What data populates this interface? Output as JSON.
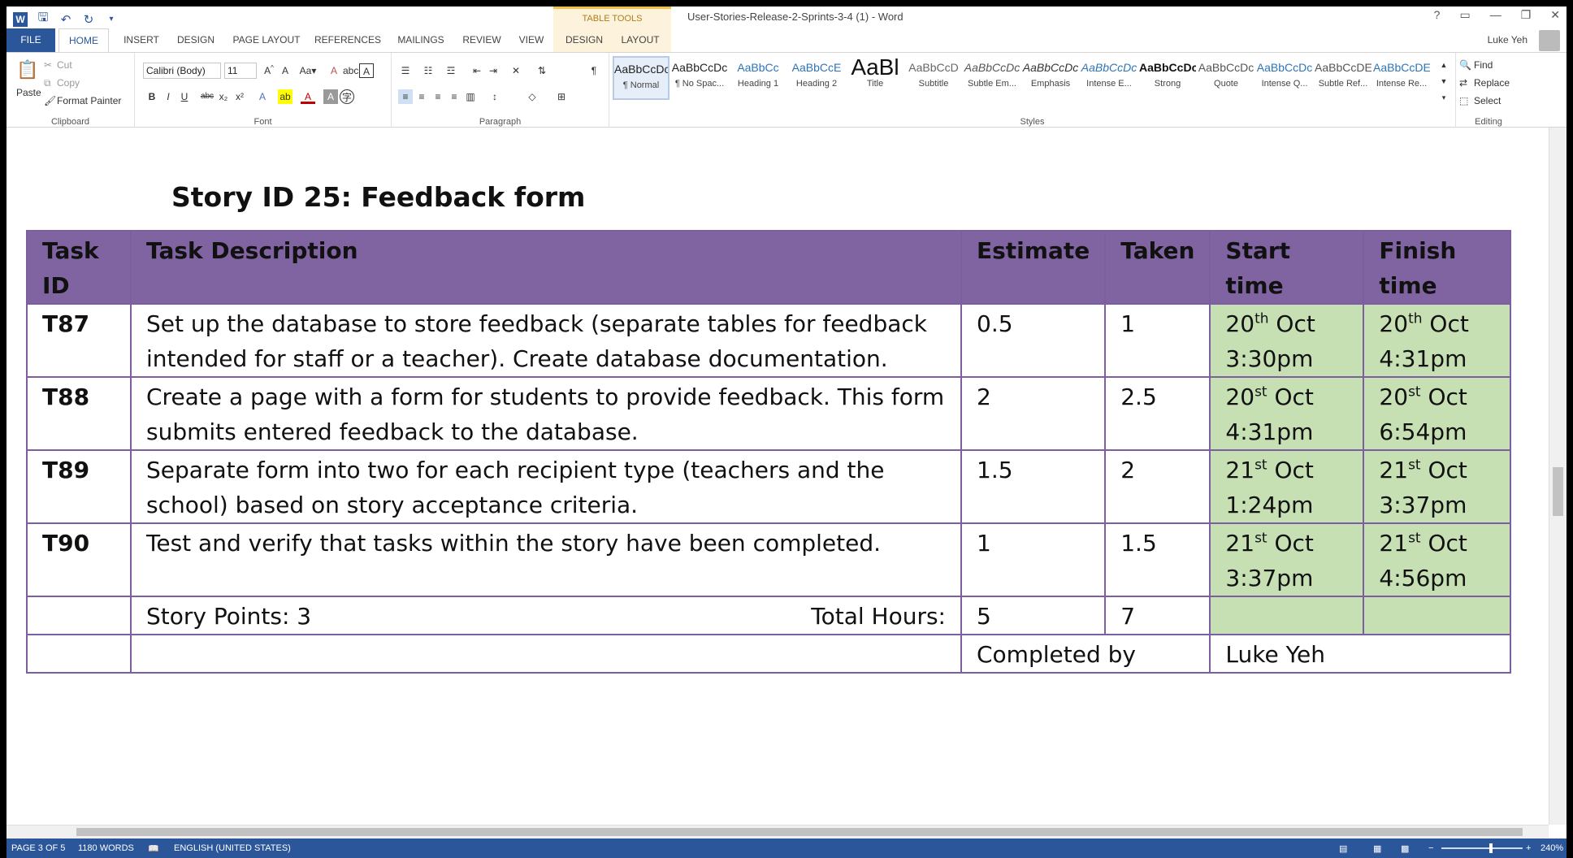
{
  "app": {
    "doc_title": "User-Stories-Release-2-Sprints-3-4 (1) - Word",
    "user": "Luke Yeh",
    "table_tools": "TABLE TOOLS"
  },
  "qat": [
    "undo-icon",
    "redo-icon",
    "save-icon"
  ],
  "tabs": [
    "FILE",
    "HOME",
    "INSERT",
    "DESIGN",
    "PAGE LAYOUT",
    "REFERENCES",
    "MAILINGS",
    "REVIEW",
    "VIEW",
    "DESIGN",
    "LAYOUT"
  ],
  "clipboard": {
    "paste": "Paste",
    "cut": "Cut",
    "copy": "Copy",
    "format_painter": "Format Painter",
    "label": "Clipboard"
  },
  "font": {
    "name": "Calibri (Body)",
    "size": "11",
    "label": "Font"
  },
  "paragraph": {
    "label": "Paragraph"
  },
  "styles": {
    "label": "Styles",
    "items": [
      {
        "preview": "AaBbCcDc",
        "name": "¶ Normal"
      },
      {
        "preview": "AaBbCcDc",
        "name": "¶ No Spac..."
      },
      {
        "preview": "AaBbCc",
        "name": "Heading 1"
      },
      {
        "preview": "AaBbCcE",
        "name": "Heading 2"
      },
      {
        "preview": "AaBl",
        "name": "Title"
      },
      {
        "preview": "AaBbCcD",
        "name": "Subtitle"
      },
      {
        "preview": "AaBbCcDc",
        "name": "Subtle Em..."
      },
      {
        "preview": "AaBbCcDc",
        "name": "Emphasis"
      },
      {
        "preview": "AaBbCcDc",
        "name": "Intense E..."
      },
      {
        "preview": "AaBbCcDc",
        "name": "Strong"
      },
      {
        "preview": "AaBbCcDc",
        "name": "Quote"
      },
      {
        "preview": "AaBbCcDc",
        "name": "Intense Q..."
      },
      {
        "preview": "AaBbCcDE",
        "name": "Subtle Ref..."
      },
      {
        "preview": "AaBbCcDE",
        "name": "Intense Re..."
      }
    ]
  },
  "editing": {
    "find": "Find",
    "replace": "Replace",
    "select": "Select",
    "label": "Editing"
  },
  "story": {
    "title": "Story ID 25: Feedback form"
  },
  "table": {
    "headers": [
      "Task ID",
      "Task Description",
      "Estimate",
      "Taken",
      "Start time",
      "Finish time"
    ],
    "rows": [
      {
        "id": "T87",
        "desc": "Set up the database to store feedback (separate tables for feedback intended for staff or a teacher). Create database documentation.",
        "est": "0.5",
        "taken": "1",
        "start_day": "20",
        "start_sup": "th",
        "start_time": "3:30pm",
        "finish_day": "20",
        "finish_sup": "th",
        "finish_time": "4:31pm"
      },
      {
        "id": "T88",
        "desc": "Create a page with a form for students to provide feedback. This form submits entered feedback to the database.",
        "est": "2",
        "taken": "2.5",
        "start_day": "20",
        "start_sup": "st",
        "start_time": "4:31pm",
        "finish_day": "20",
        "finish_sup": "st",
        "finish_time": "6:54pm"
      },
      {
        "id": "T89",
        "desc": "Separate form into two for each recipient type (teachers and the school) based on story acceptance criteria.",
        "est": "1.5",
        "taken": "2",
        "start_day": "21",
        "start_sup": "st",
        "start_time": "1:24pm",
        "finish_day": "21",
        "finish_sup": "st",
        "finish_time": "3:37pm"
      },
      {
        "id": "T90",
        "desc": "Test and verify that tasks within the story have been completed.",
        "est": "1",
        "taken": "1.5",
        "start_day": "21",
        "start_sup": "st",
        "start_time": "3:37pm",
        "finish_day": "21",
        "finish_sup": "st",
        "finish_time": "4:56pm"
      }
    ],
    "month": "Oct",
    "story_points": "Story Points: 3",
    "total_hours_label": "Total Hours:",
    "total_est": "5",
    "total_taken": "7",
    "completed_by_label": "Completed by",
    "completed_by": "Luke Yeh"
  },
  "status": {
    "page": "PAGE 3 OF 5",
    "words": "1180 WORDS",
    "language": "ENGLISH (UNITED STATES)",
    "zoom": "240%"
  }
}
